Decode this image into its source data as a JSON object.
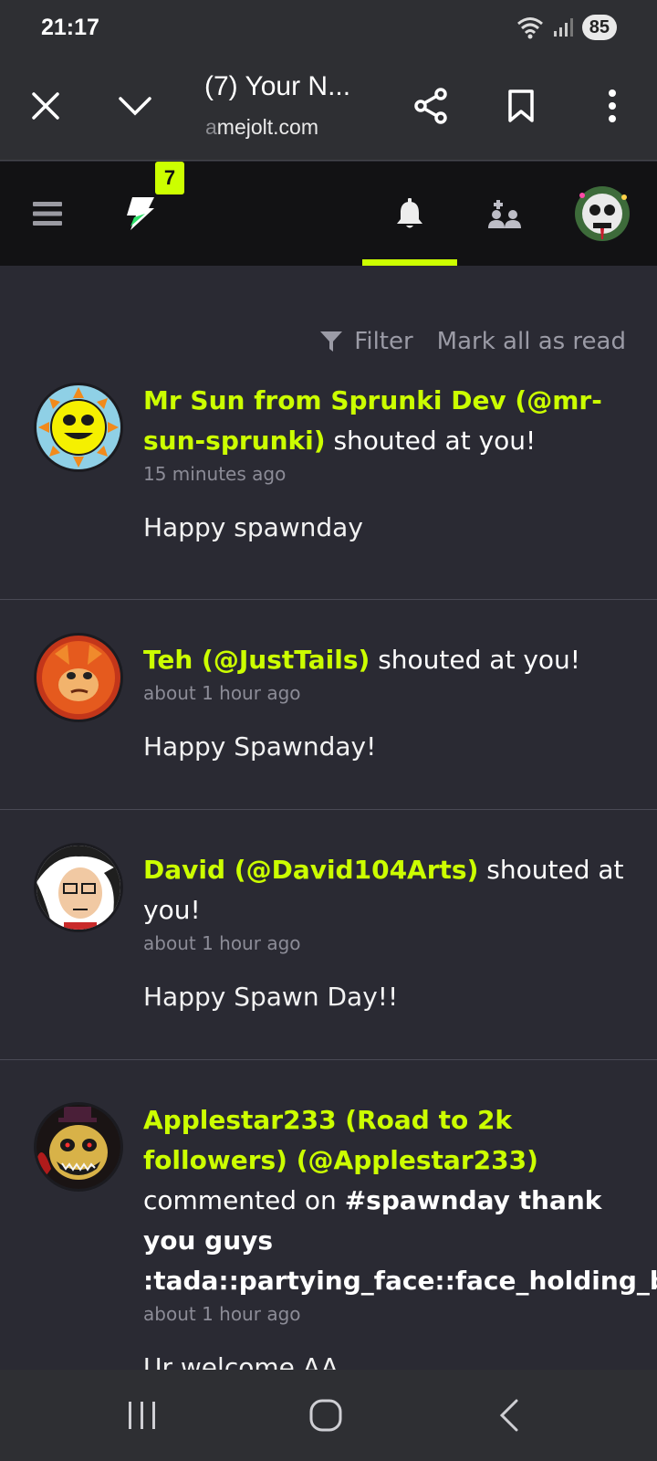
{
  "status": {
    "time": "21:17",
    "battery": "85"
  },
  "browser": {
    "title": "(7) Your N...",
    "url_faded": "a",
    "url_rest": "mejolt.com"
  },
  "site_nav": {
    "badge_count": "7"
  },
  "toolbar": {
    "filter_label": "Filter",
    "mark_all_label": "Mark all as read"
  },
  "notifications": [
    {
      "user_line1": "Mr Sun from Sprunki Dev (@mr-",
      "user_line2": "sun-sprunki)",
      "action": " shouted at you!",
      "time": "15 minutes ago",
      "message": "Happy spawnday"
    },
    {
      "user": "Teh (@JustTails)",
      "action": " shouted at you!",
      "time": "about 1 hour ago",
      "message": "Happy Spawnday!"
    },
    {
      "user": "David (@David104Arts)",
      "action": " shouted at",
      "action2": "you!",
      "time": "about 1 hour ago",
      "message": "Happy Spawn Day!!"
    },
    {
      "user_line1": "Applestar233 (Road to 2k",
      "user_line2": "followers) (@Applestar233)",
      "action": "commented on ",
      "post_line1": "#spawnday thank",
      "post_line2": "you guys",
      "post_line3": ":tada::partying_face::face_holding_back",
      "time": "about 1 hour ago",
      "message": "Ur welcome AA"
    }
  ],
  "colors": {
    "accent": "#ccff00",
    "background": "#2a2a33",
    "nav": "#121214"
  }
}
